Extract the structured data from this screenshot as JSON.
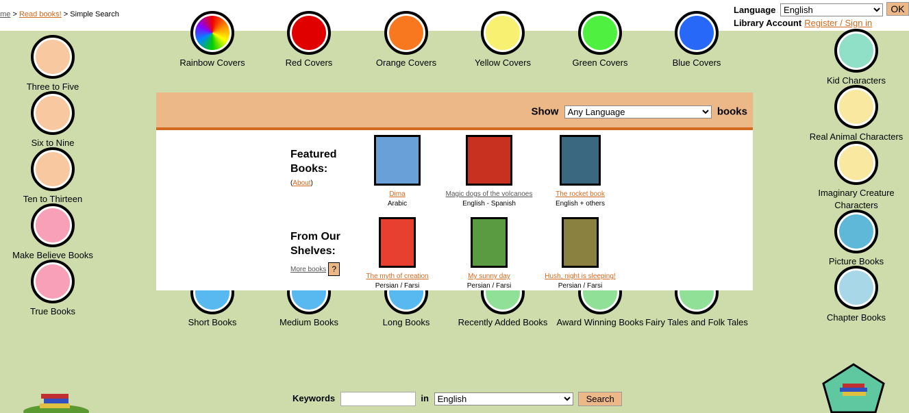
{
  "breadcrumb": {
    "home": "ome",
    "sep1": ">",
    "read": "Read books!",
    "sep2": ">",
    "current": "Simple Search"
  },
  "header": {
    "language_label": "Language",
    "language_value": "English",
    "ok": "OK",
    "account_label": "Library Account",
    "register": "Register / Sign in"
  },
  "colors": {
    "background": "#cddcaa",
    "accent": "#ecb888",
    "link": "#d2691e"
  },
  "color_covers": [
    {
      "label": "Rainbow Covers",
      "color": "rainbow"
    },
    {
      "label": "Red Covers",
      "color": "#e00000"
    },
    {
      "label": "Orange Covers",
      "color": "#f87820"
    },
    {
      "label": "Yellow Covers",
      "color": "#f8f070"
    },
    {
      "label": "Green Covers",
      "color": "#50f040"
    },
    {
      "label": "Blue Covers",
      "color": "#2868f8"
    }
  ],
  "left_nav": [
    {
      "label": "Three to Five",
      "icon": "toddler-icon",
      "color": "#f8c8a0"
    },
    {
      "label": "Six to Nine",
      "icon": "running-child-icon",
      "color": "#f8c8a0"
    },
    {
      "label": "Ten to Thirteen",
      "icon": "running-girl-icon",
      "color": "#f8c8a0"
    },
    {
      "label": "Make Believe Books",
      "icon": "mermaid-icon",
      "color": "#f8a0b8"
    },
    {
      "label": "True Books",
      "icon": "fish-icon",
      "color": "#f8a0b8"
    }
  ],
  "right_nav": [
    {
      "label": "Kid Characters",
      "icon": "kids-icon",
      "color": "#90e0c8"
    },
    {
      "label": "Real Animal Characters",
      "icon": "tiger-icon",
      "color": "#f8e8a0"
    },
    {
      "label": "Imaginary Creature Characters",
      "icon": "unicorn-icon",
      "color": "#f8e8a0"
    },
    {
      "label": "Picture Books",
      "icon": "picture-book-icon",
      "color": "#60b8d8"
    },
    {
      "label": "Chapter Books",
      "icon": "chapter-book-icon",
      "color": "#a8d8e8"
    }
  ],
  "bottom_nav": [
    {
      "label": "Short Books",
      "icon": "short-book-icon",
      "color": "#58b8f0"
    },
    {
      "label": "Medium Books",
      "icon": "medium-book-icon",
      "color": "#58b8f0"
    },
    {
      "label": "Long Books",
      "icon": "long-book-icon",
      "color": "#58b8f0"
    },
    {
      "label": "Recently Added Books",
      "icon": "computer-icon",
      "color": "#90e098"
    },
    {
      "label": "Award Winning Books",
      "icon": "medal-icon",
      "color": "#90e098"
    },
    {
      "label": "Fairy Tales and Folk Tales",
      "icon": "magic-lamp-icon",
      "color": "#90e098"
    }
  ],
  "panel": {
    "show": "Show",
    "language_filter": "Any Language",
    "books": "books",
    "featured_title": "Featured Books:",
    "about": "About",
    "shelves_title": "From Our Shelves:",
    "more_books": "More books",
    "help": "?",
    "featured": [
      {
        "title": "Dima",
        "lang": "Arabic",
        "cover": "#6aa0d8"
      },
      {
        "title": "Magic dogs of the volcanoes",
        "lang": "English - Spanish",
        "cover": "#c83020"
      },
      {
        "title": "The rocket book",
        "lang": "English + others",
        "cover": "#3a6880"
      }
    ],
    "shelves": [
      {
        "title": "The myth of creation",
        "lang": "Persian / Farsi",
        "cover": "#e84030"
      },
      {
        "title": "My sunny day",
        "lang": "Persian / Farsi",
        "cover": "#5a9a40"
      },
      {
        "title": "Hush, night is sleeping!",
        "lang": "Persian / Farsi",
        "cover": "#8a8040"
      }
    ]
  },
  "search": {
    "keywords": "Keywords",
    "in": "in",
    "language": "English",
    "button": "Search",
    "value": ""
  }
}
